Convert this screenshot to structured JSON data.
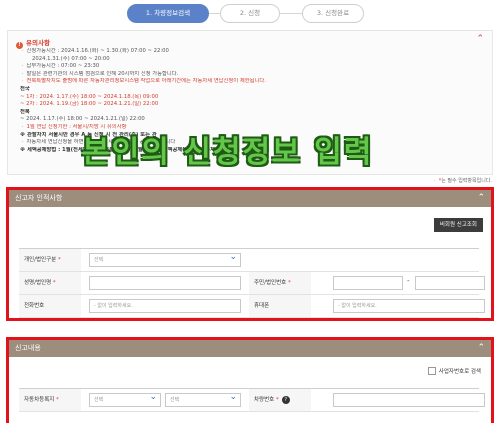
{
  "steps": [
    {
      "label": "1. 차량정보검색",
      "active": true
    },
    {
      "label": "2. 신청",
      "active": false
    },
    {
      "label": "3. 신청완료",
      "active": false
    }
  ],
  "notice": {
    "title": "유의사항",
    "lines": [
      {
        "text": "ㆍ 신청가능시간 : 2024.1.16.(화) ~ 1.30.(화) 07:00 ~ 22:00",
        "style": ""
      },
      {
        "text": "2024.1.31.(수) 07:00 ~ 20:00",
        "style": "ind"
      },
      {
        "text": "ㆍ 납부가능시간 : 07:00 ~ 23:30",
        "style": ""
      },
      {
        "text": "ㆍ 말일은 관련기관의 시스템 점검으로 인해 20시까지 신청 가능합니다.",
        "style": ""
      },
      {
        "text": "ㆍ 전북특별자치도 출범에 따른 자동차관리정보시스템 작업으로 아래기간에는 자동차세 연납신청이 제한됩니다.",
        "style": "red"
      },
      {
        "text": "전국",
        "style": "bold"
      },
      {
        "text": "~ 1차 : 2024. 1.17.(수) 18:00 ~ 2024.1.18.(목) 09:00",
        "style": "red"
      },
      {
        "text": "~ 2차 : 2024. 1.19.(금) 18:00 ~ 2024.1.21.(일) 22:00",
        "style": "red"
      },
      {
        "text": "전북",
        "style": "bold"
      },
      {
        "text": "~ 2024. 1.17.(수) 18:00 ~ 2024.1.21.(일) 22:00",
        "style": ""
      },
      {
        "text": "ㆍ 1월 연납 신청기한 : 서울시/지방 시 유의사항",
        "style": "red"
      },
      {
        "text": "※ 관할자치 서울시만 경우 A 등 신청 시 전 관리(주) 또는 관",
        "style": "bold"
      },
      {
        "text": "ㆍ 자동차세 연납신청을 하면 신 · 시 설 세액의 3%를 공제해 드립니다",
        "style": ""
      },
      {
        "text": "※ 세액공제방법 : 1월(전세액공제) · 3월 · 6월 · 9월 신청 시 세액공제율에 따라 공제됩니다",
        "style": "bold"
      }
    ]
  },
  "overlay_caption": "본인의 신청정보 입력",
  "required_note": "는 필수 입력항목입니다.",
  "required_star": "*",
  "section1": {
    "title": "신고자 인적사항",
    "lookup_button": "비회원 신고조회",
    "fields": {
      "type_label": "개인/법인구분",
      "type_value": "선택",
      "name_label": "성명/법인명",
      "rrn_label": "주민/법인번호",
      "rrn_sep": "-",
      "phone_label": "전화번호",
      "phone_placeholder": "- 없이 입력하세요.",
      "mobile_label": "휴대폰",
      "mobile_placeholder": "- 없이 입력하세요."
    }
  },
  "section2": {
    "title": "신고내용",
    "biz_checkbox": "사업자번호로 검색",
    "fields": {
      "region_label": "자동차등록지",
      "region_sel1": "선택",
      "region_sel2": "선택",
      "car_label": "차량번호"
    }
  },
  "colors": {
    "accent": "#5b82c8",
    "header": "#9c8d7d",
    "highlight": "#e1121a",
    "caption": "#64c64a"
  }
}
